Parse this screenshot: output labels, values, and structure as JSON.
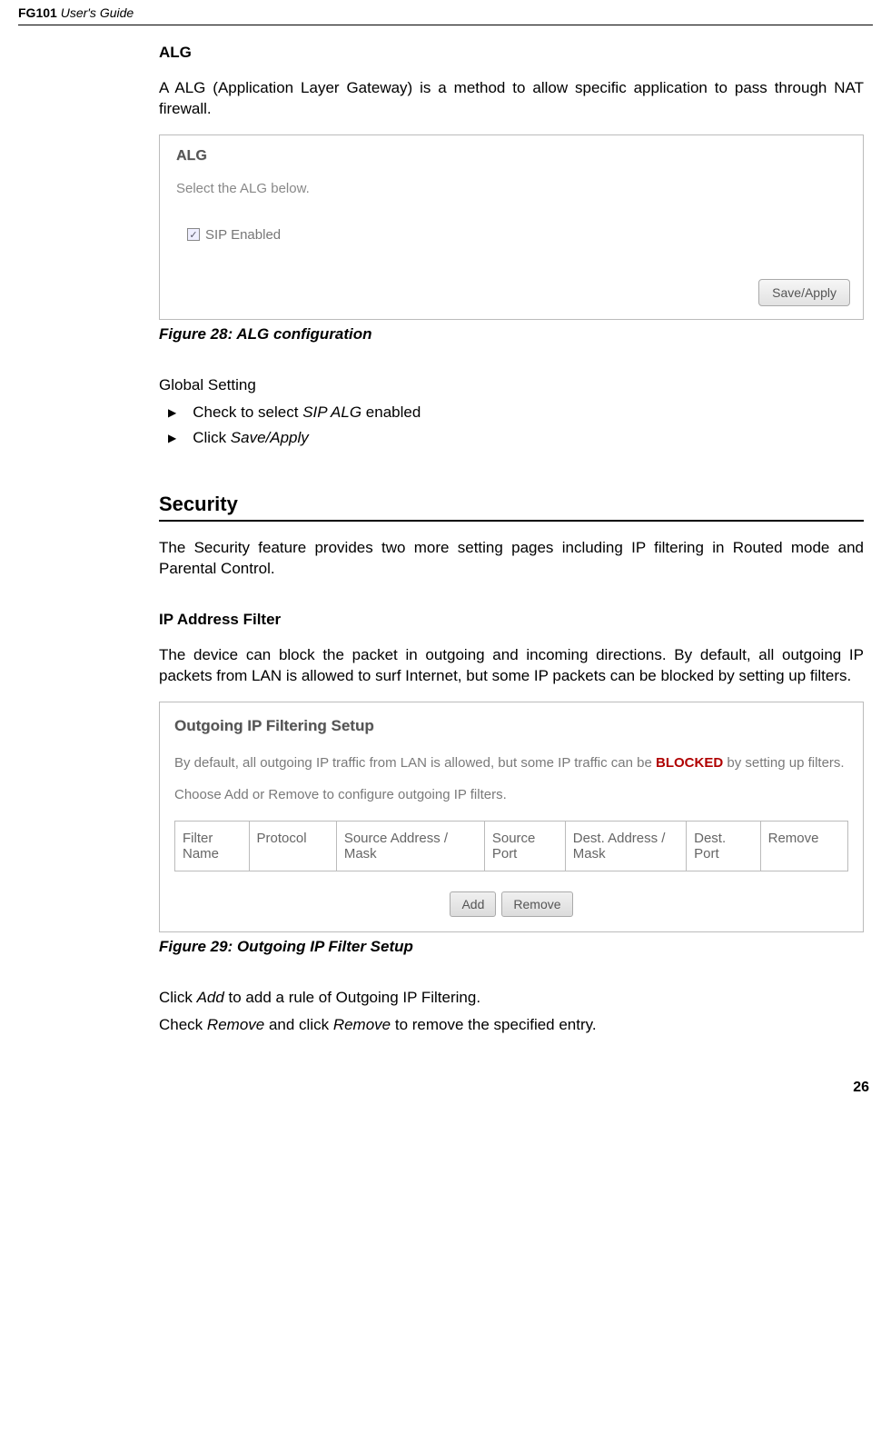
{
  "header": {
    "product": "FG101",
    "subtitle": "User's Guide"
  },
  "alg": {
    "heading": "ALG",
    "body": "A ALG (Application Layer Gateway) is a method to allow specific application to pass through NAT firewall.",
    "ss_title": "ALG",
    "ss_select": "Select the ALG below.",
    "ss_checkbox_label": "SIP Enabled",
    "ss_checkbox_mark": "☑",
    "ss_save_btn": "Save/Apply",
    "figure": "Figure 28: ALG configuration",
    "global_setting": "Global Setting",
    "bullets": [
      {
        "pre": "Check to select ",
        "em": "SIP ALG",
        "post": " enabled"
      },
      {
        "pre": "Click ",
        "em": "Save/Apply",
        "post": ""
      }
    ]
  },
  "security": {
    "heading": "Security",
    "body": "The Security feature provides two more setting pages including IP filtering in Routed mode and Parental Control.",
    "ip_filter_heading": "IP Address Filter",
    "ip_filter_body": "The device can block the packet in outgoing and incoming directions. By default, all outgoing IP packets from LAN is allowed to surf Internet, but some IP packets can be blocked by setting up filters.",
    "ss_title": "Outgoing IP Filtering Setup",
    "ss_line1_pre": "By default, all outgoing IP traffic from LAN is allowed, but some IP traffic can be ",
    "ss_line1_blocked": "BLOCKED",
    "ss_line1_post": " by setting up filters.",
    "ss_line2": "Choose Add or Remove to configure outgoing IP filters.",
    "table_headers": [
      "Filter Name",
      "Protocol",
      "Source Address / Mask",
      "Source Port",
      "Dest. Address / Mask",
      "Dest. Port",
      "Remove"
    ],
    "btn_add": "Add",
    "btn_remove": "Remove",
    "figure": "Figure 29: Outgoing IP Filter Setup",
    "click_add_pre": "Click ",
    "click_add_em": "Add",
    "click_add_post": " to add a rule of Outgoing IP Filtering.",
    "check_remove_pre": "Check ",
    "check_remove_em1": "Remove",
    "check_remove_mid": " and click ",
    "check_remove_em2": "Remove",
    "check_remove_post": " to remove the specified entry."
  },
  "page_number": "26"
}
